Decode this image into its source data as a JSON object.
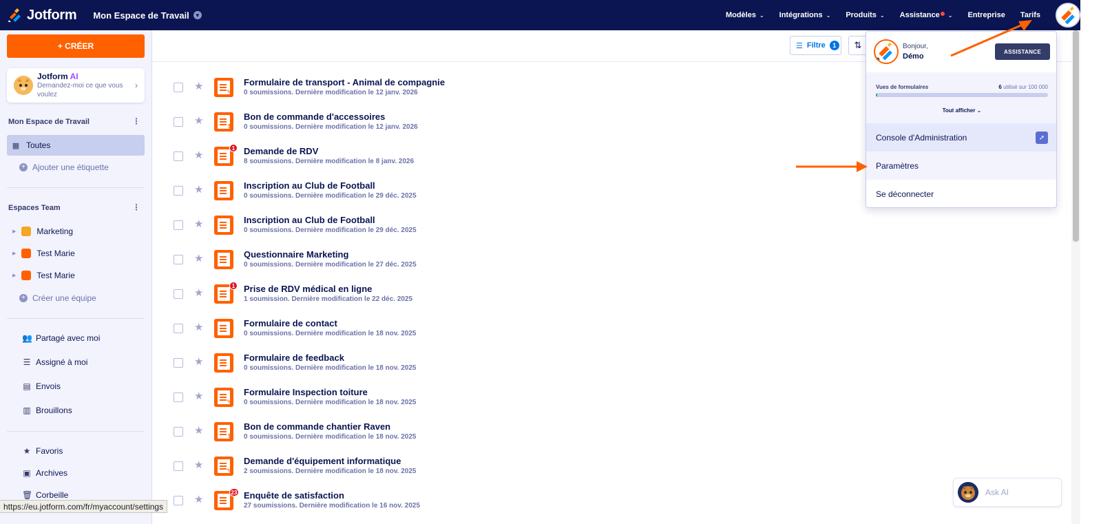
{
  "header": {
    "logo_text": "Jotform",
    "workspace_title": "Mon Espace de Travail",
    "nav": [
      {
        "label": "Modèles",
        "caret": "⌄"
      },
      {
        "label": "Intégrations",
        "caret": "⌄"
      },
      {
        "label": "Produits",
        "caret": "⌄"
      },
      {
        "label": "Assistance",
        "caret": "⌄"
      },
      {
        "label": "Entreprise"
      },
      {
        "label": "Tarifs"
      }
    ]
  },
  "sidebar": {
    "create_label": "+ CRÉER",
    "ai_card": {
      "title": "Jotform",
      "title_accent": "AI",
      "subtitle": "Demandez-moi ce que vous voulez"
    },
    "workspace_heading": "Mon Espace de Travail",
    "all_label": "Toutes",
    "add_label": "Ajouter une étiquette",
    "teams_heading": "Espaces Team",
    "teams": [
      {
        "label": "Marketing",
        "color": "#f5a623"
      },
      {
        "label": "Test Marie",
        "color": "#ff6100"
      },
      {
        "label": "Test Marie",
        "color": "#ff6100"
      }
    ],
    "create_team_label": "Créer une équipe",
    "utility": [
      {
        "label": "Partagé avec moi",
        "icon": "users-icon",
        "glyph": "👥"
      },
      {
        "label": "Assigné à moi",
        "icon": "checklist-icon",
        "glyph": "☰"
      },
      {
        "label": "Envois",
        "icon": "message-icon",
        "glyph": "▤"
      },
      {
        "label": "Brouillons",
        "icon": "draft-icon",
        "glyph": "▥"
      }
    ],
    "bottom": [
      {
        "label": "Favoris",
        "icon": "star-icon",
        "glyph": "★"
      },
      {
        "label": "Archives",
        "icon": "archive-icon",
        "glyph": "▣"
      },
      {
        "label": "Corbeille",
        "icon": "trash-icon",
        "glyph": "🗑"
      }
    ]
  },
  "toolbar": {
    "filter_label": "Filtre",
    "filter_count": "1"
  },
  "forms": [
    {
      "title": "Formulaire de transport - Animal de compagnie",
      "meta": "0 soumissions. Dernière modification le 12 janv. 2026",
      "sym": "✎",
      "badge": ""
    },
    {
      "title": "Bon de commande d'accessoires",
      "meta": "0 soumissions. Dernière modification le 12 janv. 2026",
      "sym": "$",
      "badge": ""
    },
    {
      "title": "Demande de RDV",
      "meta": "8 soumissions. Dernière modification le 8 janv. 2026",
      "sym": "",
      "badge": "1"
    },
    {
      "title": "Inscription au Club de Football",
      "meta": "0 soumissions. Dernière modification le 29 déc. 2025",
      "sym": "",
      "badge": ""
    },
    {
      "title": "Inscription au Club de Football",
      "meta": "0 soumissions. Dernière modification le 29 déc. 2025",
      "sym": "",
      "badge": ""
    },
    {
      "title": "Questionnaire Marketing",
      "meta": "0 soumissions. Dernière modification le 27 déc. 2025",
      "sym": "",
      "badge": ""
    },
    {
      "title": "Prise de RDV médical en ligne",
      "meta": "1 soumission. Dernière modification le 22 déc. 2025",
      "sym": "",
      "badge": "1"
    },
    {
      "title": "Formulaire de contact",
      "meta": "0 soumissions. Dernière modification le 18 nov. 2025",
      "sym": "",
      "badge": ""
    },
    {
      "title": "Formulaire de feedback",
      "meta": "0 soumissions. Dernière modification le 18 nov. 2025",
      "sym": "",
      "badge": ""
    },
    {
      "title": "Formulaire Inspection toiture",
      "meta": "0 soumissions. Dernière modification le 18 nov. 2025",
      "sym": "✎",
      "badge": ""
    },
    {
      "title": "Bon de commande chantier Raven",
      "meta": "0 soumissions. Dernière modification le 18 nov. 2025",
      "sym": "$",
      "badge": ""
    },
    {
      "title": "Demande d'équipement informatique",
      "meta": "2 soumissions. Dernière modification le 18 nov. 2025",
      "sym": "✎",
      "badge": ""
    },
    {
      "title": "Enquête de satisfaction",
      "meta": "27 soumissions. Dernière modification le 16 nov. 2025",
      "sym": "",
      "badge": "23"
    }
  ],
  "dropdown": {
    "greeting": "Bonjour,",
    "name": "Démo",
    "assist_label": "ASSISTANCE",
    "usage_label": "Vues de formulaires",
    "usage_used": "6",
    "usage_rest": "utilisé sur 100 000",
    "usage_fraction": 6e-05,
    "show_all": "Tout afficher ⌄",
    "items": [
      "Console d'Administration",
      "Paramètres",
      "Se déconnecter"
    ]
  },
  "ask_ai_label": "Ask AI",
  "status_url": "https://eu.jotform.com/fr/myaccount/settings",
  "colors": {
    "brand_orange": "#ff6100",
    "navy": "#0a1551",
    "annotation_arrow": "#ff6100"
  }
}
